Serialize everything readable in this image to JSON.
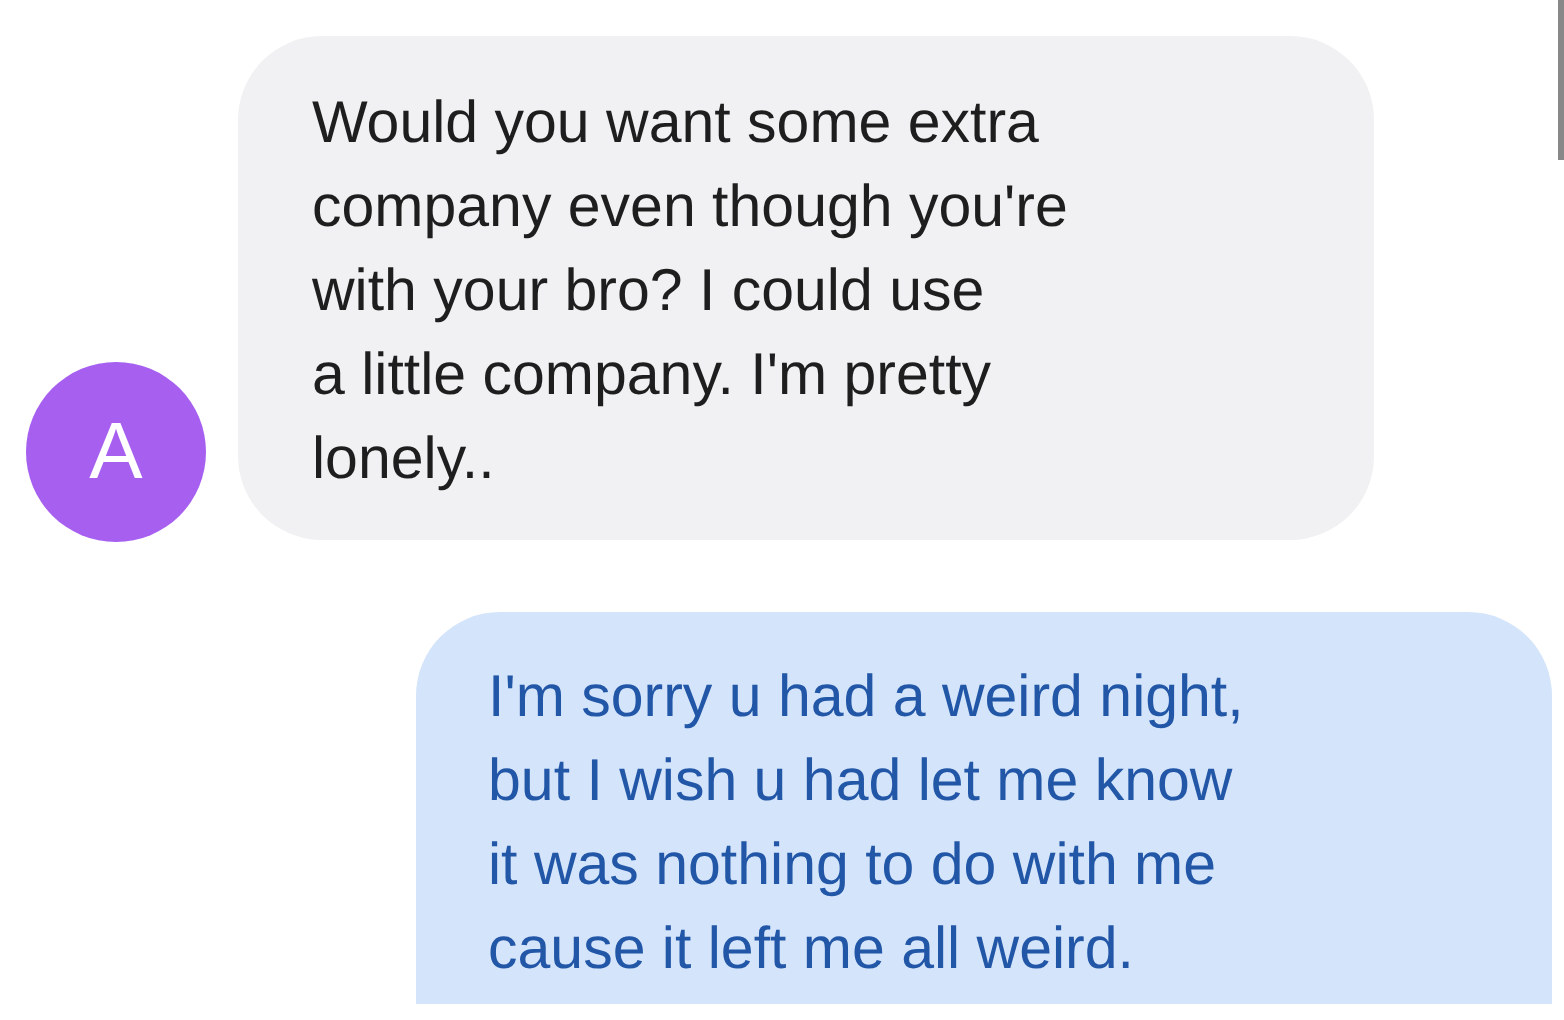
{
  "messages": [
    {
      "kind": "incoming",
      "avatar": "A",
      "text": "Would you want some extra\ncompany even though you're\nwith your bro? I could use\na little company. I'm pretty\nlonely.."
    },
    {
      "kind": "outgoing",
      "text": "I'm sorry u had a weird night,\nbut I wish u had let me know\nit was nothing to do with me\ncause it left me all weird."
    }
  ]
}
